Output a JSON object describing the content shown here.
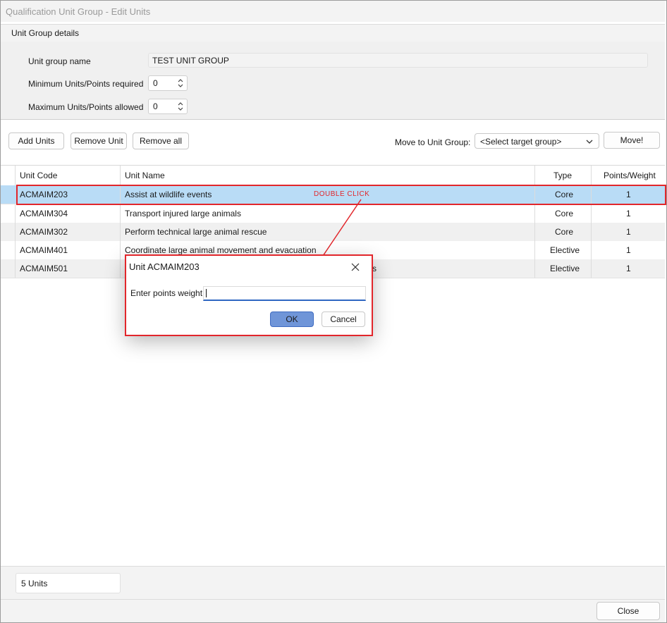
{
  "window": {
    "title": "Qualification Unit Group - Edit Units"
  },
  "group": {
    "header": "Unit Group details"
  },
  "form": {
    "name_label": "Unit group name",
    "name_value": "TEST UNIT GROUP",
    "min_label": "Minimum Units/Points required",
    "min_value": "0",
    "max_label": "Maximum Units/Points allowed",
    "max_value": "0"
  },
  "toolbar": {
    "add_units": "Add Units",
    "remove_unit": "Remove Unit",
    "remove_all": "Remove all",
    "move_label": "Move to Unit Group:",
    "target_select": "<Select target group>",
    "move_button": "Move!"
  },
  "table": {
    "columns": [
      "Unit Code",
      "Unit Name",
      "Type",
      "Points/Weight"
    ],
    "rows": [
      {
        "code": "ACMAIM203",
        "name": "Assist at wildlife events",
        "type": "Core",
        "points": "1"
      },
      {
        "code": "ACMAIM304",
        "name": "Transport injured large animals",
        "type": "Core",
        "points": "1"
      },
      {
        "code": "ACMAIM302",
        "name": "Perform technical large animal rescue",
        "type": "Core",
        "points": "1"
      },
      {
        "code": "ACMAIM401",
        "name": "Coordinate large animal movement and evacuation",
        "type": "Elective",
        "points": "1"
      },
      {
        "code": "ACMAIM501",
        "name": "s",
        "type": "Elective",
        "points": "1"
      }
    ]
  },
  "status": {
    "count": "5 Units"
  },
  "footer": {
    "close": "Close"
  },
  "annotation": {
    "text": "DOUBLE CLICK"
  },
  "dialog": {
    "title": "Unit ACMAIM203",
    "prompt": "Enter points weight:",
    "input_value": "",
    "ok": "OK",
    "cancel": "Cancel"
  },
  "colors": {
    "highlight": "#e2262b",
    "selection": "#b9dcf6",
    "ok_button": "#6f95d8"
  },
  "icons": {
    "close": "close-icon",
    "spin": "spin-arrows-icon",
    "dropdown": "chevron-down-icon"
  }
}
